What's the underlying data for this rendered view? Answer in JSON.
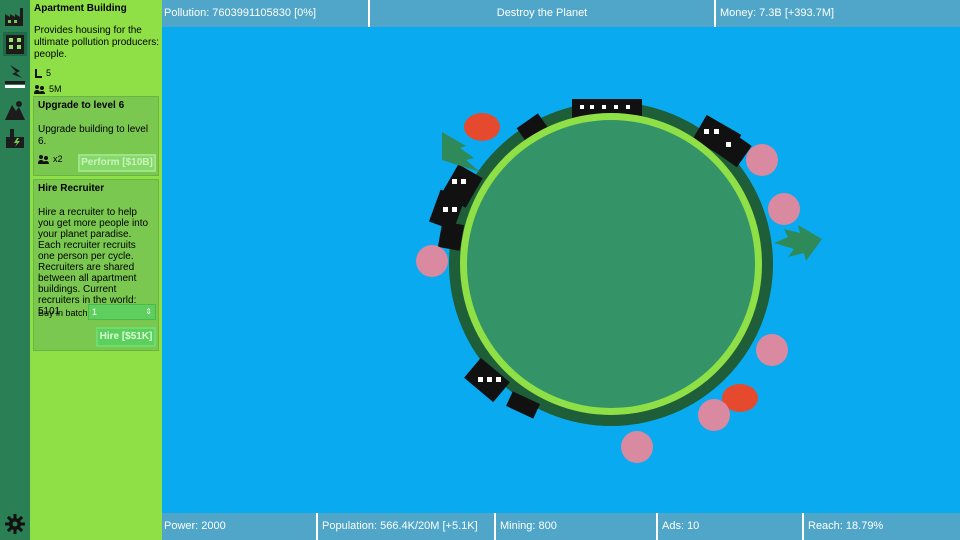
{
  "top": {
    "pollution": "Pollution: 7603991105830 [0%]",
    "title": "Destroy the Planet",
    "money": "Money: 7.3B [+393.7M]"
  },
  "bottom": {
    "power": "Power: 2000",
    "population": "Population: 566.4K/20M [+5.1K]",
    "mining": "Mining: 800",
    "ads": "Ads: 10",
    "reach": "Reach: 18.79%"
  },
  "panel": {
    "building": {
      "title": "Apartment Building",
      "desc": "Provides housing for the ultimate pollution producers: people.",
      "level": "5",
      "capacity": "5M"
    },
    "upgrade": {
      "title": "Upgrade to level 6",
      "desc": "Upgrade building to level 6.",
      "multiplier": "x2",
      "button": "Perform [$10B]"
    },
    "recruiter": {
      "title": "Hire Recruiter",
      "desc": "Hire a recruiter to help you get more people into your planet paradise. Each recruiter recruits one person per cycle. Recruiters are shared between all apartment buildings. Current recruiters in the world: 5101",
      "batch_label": "Buy in batch:",
      "batch_value": "1",
      "button": "Hire [$51K]"
    }
  },
  "rail_icons": [
    "factory-icon",
    "apartment-icon",
    "power-icon",
    "mine-icon",
    "power-plant-icon",
    "settings-gear-icon"
  ]
}
